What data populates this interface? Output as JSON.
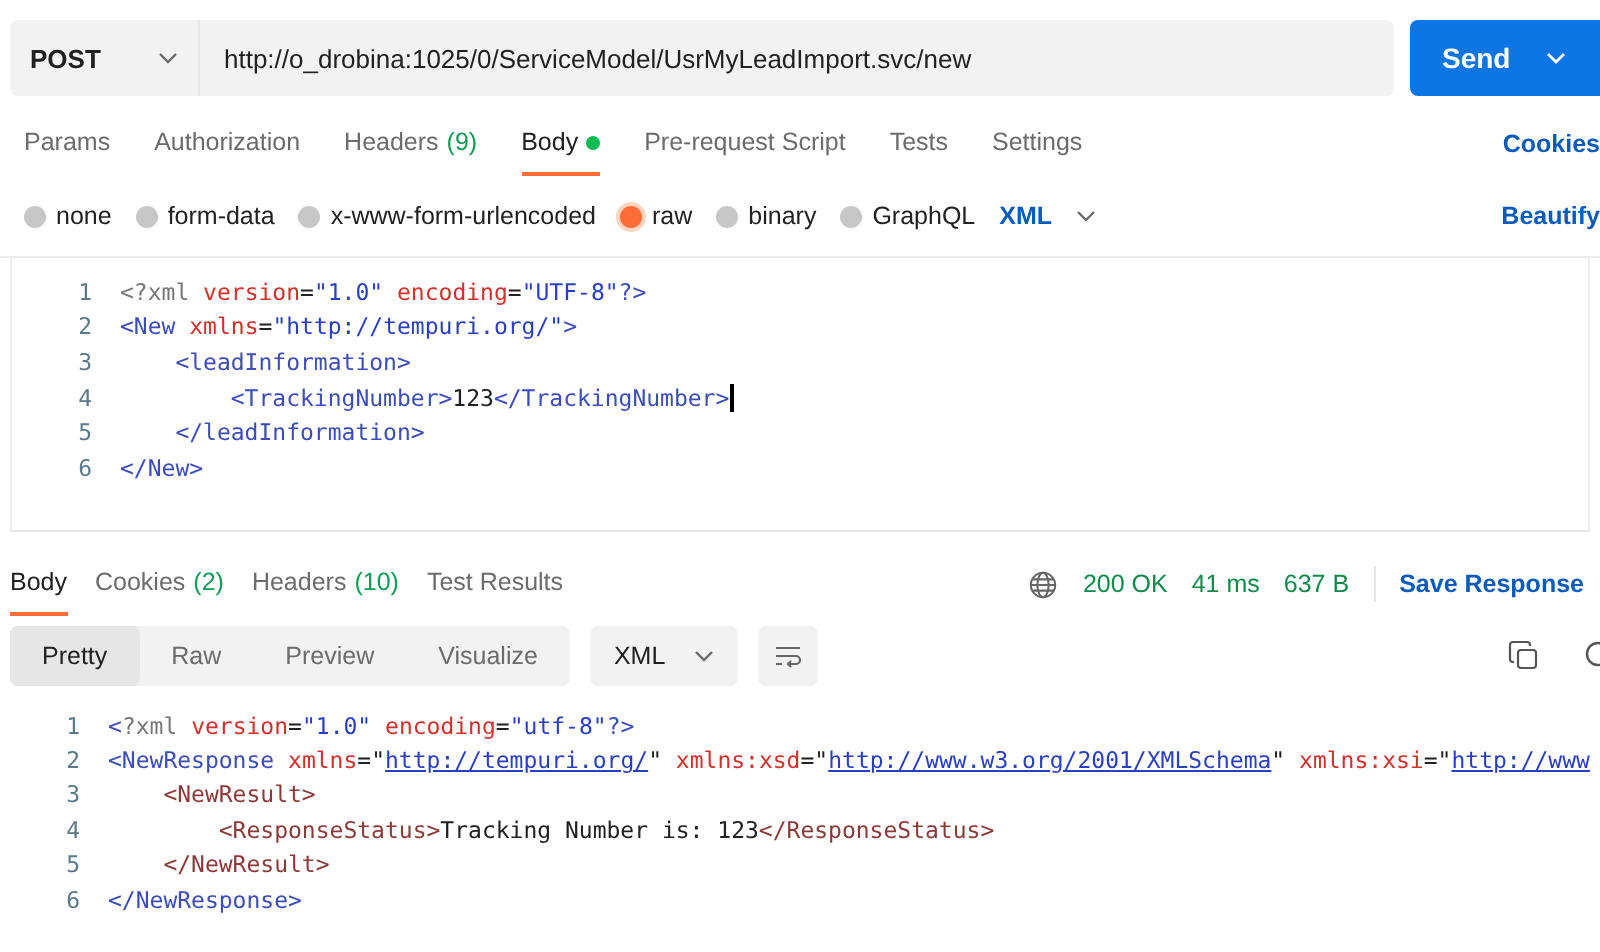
{
  "request": {
    "method": "POST",
    "url": "http://o_drobina:1025/0/ServiceModel/UsrMyLeadImport.svc/new",
    "send": "Send"
  },
  "request_tabs": [
    {
      "label": "Params",
      "selected": false,
      "dot": false
    },
    {
      "label": "Authorization",
      "selected": false,
      "dot": false
    },
    {
      "label": "Headers",
      "count": "(9)",
      "selected": false,
      "dot": false
    },
    {
      "label": "Body",
      "selected": true,
      "dot": true
    },
    {
      "label": "Pre-request Script",
      "selected": false,
      "dot": false
    },
    {
      "label": "Tests",
      "selected": false,
      "dot": false
    },
    {
      "label": "Settings",
      "selected": false,
      "dot": false
    }
  ],
  "cookies_link": "Cookies",
  "body_types": [
    {
      "label": "none",
      "selected": false
    },
    {
      "label": "form-data",
      "selected": false
    },
    {
      "label": "x-www-form-urlencoded",
      "selected": false
    },
    {
      "label": "raw",
      "selected": true
    },
    {
      "label": "binary",
      "selected": false
    },
    {
      "label": "GraphQL",
      "selected": false
    }
  ],
  "body_format": "XML",
  "beautify": "Beautify",
  "request_body": [
    {
      "number": "1",
      "tokens": [
        {
          "kind": "punct",
          "text": "<?xml"
        },
        {
          "kind": "attr",
          "text": " version"
        },
        {
          "kind": "text",
          "text": "="
        },
        {
          "kind": "value",
          "text": "\"1.0\""
        },
        {
          "kind": "attr",
          "text": " encoding"
        },
        {
          "kind": "text",
          "text": "="
        },
        {
          "kind": "value",
          "text": "\"UTF-8\""
        },
        {
          "kind": "tag",
          "text": "?>"
        }
      ]
    },
    {
      "number": "2",
      "tokens": [
        {
          "kind": "tag",
          "text": "<New"
        },
        {
          "kind": "attr",
          "text": " xmlns"
        },
        {
          "kind": "text",
          "text": "="
        },
        {
          "kind": "value",
          "text": "\"http://tempuri.org/\""
        },
        {
          "kind": "tag",
          "text": ">"
        }
      ]
    },
    {
      "number": "3",
      "tokens": [
        {
          "kind": "tag",
          "text": "    <leadInformation>"
        }
      ]
    },
    {
      "number": "4",
      "tokens": [
        {
          "kind": "tag",
          "text": "        <TrackingNumber>"
        },
        {
          "kind": "text",
          "text": "123"
        },
        {
          "kind": "tag",
          "text": "</TrackingNumber>"
        }
      ],
      "cursor": true
    },
    {
      "number": "5",
      "tokens": [
        {
          "kind": "tag",
          "text": "    </leadInformation>"
        }
      ]
    },
    {
      "number": "6",
      "tokens": [
        {
          "kind": "tag",
          "text": "</New>"
        }
      ]
    }
  ],
  "response_tabs": [
    {
      "label": "Body",
      "selected": true
    },
    {
      "label": "Cookies",
      "count": "(2)",
      "selected": false
    },
    {
      "label": "Headers",
      "count": "(10)",
      "selected": false
    },
    {
      "label": "Test Results",
      "selected": false
    }
  ],
  "status": {
    "code": "200 OK",
    "time": "41 ms",
    "size": "637 B",
    "save": "Save Response"
  },
  "view_modes": [
    {
      "label": "Pretty",
      "selected": true
    },
    {
      "label": "Raw",
      "selected": false
    },
    {
      "label": "Preview",
      "selected": false
    },
    {
      "label": "Visualize",
      "selected": false
    }
  ],
  "response_format": "XML",
  "response_body": [
    {
      "number": "1",
      "tokens": [
        {
          "kind": "tag",
          "text": "<"
        },
        {
          "kind": "punct",
          "text": "?xml"
        },
        {
          "kind": "attr",
          "text": " version"
        },
        {
          "kind": "text",
          "text": "="
        },
        {
          "kind": "value",
          "text": "\"1.0\""
        },
        {
          "kind": "attr",
          "text": " encoding"
        },
        {
          "kind": "text",
          "text": "="
        },
        {
          "kind": "value",
          "text": "\"utf-8\""
        },
        {
          "kind": "tag",
          "text": "?>"
        }
      ]
    },
    {
      "number": "2",
      "tokens": [
        {
          "kind": "tag",
          "text": "<NewResponse"
        },
        {
          "kind": "attr",
          "text": " xmlns"
        },
        {
          "kind": "text",
          "text": "=\""
        },
        {
          "kind": "link",
          "text": "http://tempuri.org/"
        },
        {
          "kind": "text",
          "text": "\""
        },
        {
          "kind": "attr",
          "text": " xmlns:xsd"
        },
        {
          "kind": "text",
          "text": "=\""
        },
        {
          "kind": "link",
          "text": "http://www.w3.org/2001/XMLSchema"
        },
        {
          "kind": "text",
          "text": "\""
        },
        {
          "kind": "attr",
          "text": " xmlns:xsi"
        },
        {
          "kind": "text",
          "text": "=\""
        },
        {
          "kind": "link",
          "text": "http://www"
        }
      ]
    },
    {
      "number": "3",
      "tokens": [
        {
          "kind": "tag2",
          "text": "    <NewResult>"
        }
      ]
    },
    {
      "number": "4",
      "tokens": [
        {
          "kind": "tag2",
          "text": "        <ResponseStatus>"
        },
        {
          "kind": "text",
          "text": "Tracking Number is: 123"
        },
        {
          "kind": "tag2",
          "text": "</ResponseStatus>"
        }
      ]
    },
    {
      "number": "5",
      "tokens": [
        {
          "kind": "tag2",
          "text": "    </NewResult>"
        }
      ]
    },
    {
      "number": "6",
      "tokens": [
        {
          "kind": "tag",
          "text": "</NewResponse>"
        }
      ]
    }
  ]
}
